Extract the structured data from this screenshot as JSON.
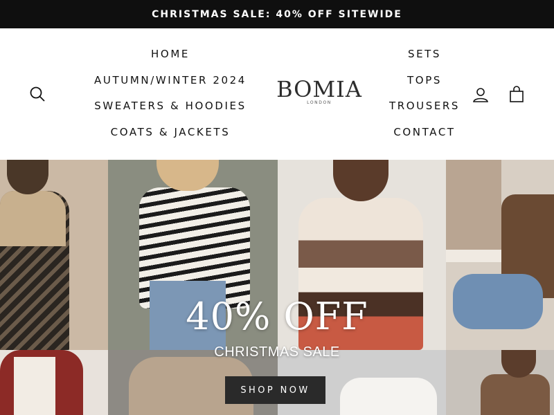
{
  "announcement": {
    "text": "CHRISTMAS SALE: 40% OFF SITEWIDE"
  },
  "header": {
    "logo": {
      "word": "BOMIA",
      "sub": "LONDON"
    },
    "nav_left": [
      {
        "label": "HOME"
      },
      {
        "label": "AUTUMN/WINTER 2024"
      },
      {
        "label": "SWEATERS & HOODIES"
      },
      {
        "label": "COATS & JACKETS"
      }
    ],
    "nav_right": [
      {
        "label": "SETS"
      },
      {
        "label": "TOPS"
      },
      {
        "label": "TROUSERS"
      },
      {
        "label": "CONTACT"
      }
    ],
    "icons": [
      "search-icon",
      "account-icon",
      "cart-icon"
    ]
  },
  "hero": {
    "title": "40% OFF",
    "subtitle": "CHRISTMAS SALE",
    "button_label": "SHOP NOW"
  },
  "colors": {
    "announcement_bg": "#0f0f0f",
    "button_bg": "#2a2a2a",
    "text": "#111111"
  }
}
